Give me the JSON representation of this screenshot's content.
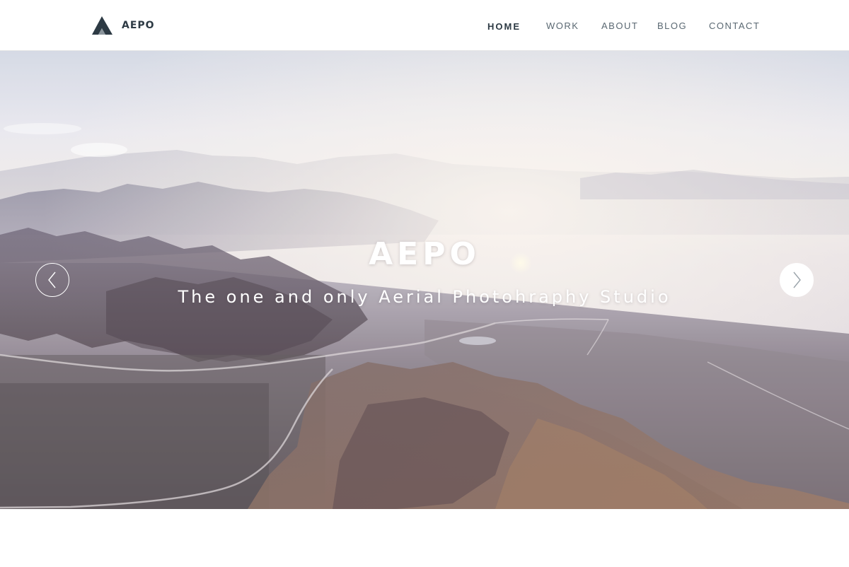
{
  "brand": {
    "name": "AEPO",
    "logo_icon": "mountain-peak-icon",
    "color": "#2d3a44"
  },
  "nav": {
    "items": [
      {
        "label": "HOME",
        "active": true
      },
      {
        "label": "WORK",
        "active": false
      },
      {
        "label": "ABOUT",
        "active": false
      },
      {
        "label": "BLOG",
        "active": false
      },
      {
        "label": "CONTACT",
        "active": false
      }
    ]
  },
  "hero": {
    "title": "AEPO",
    "subtitle": "The one and only Aerial Photohraphy Studio",
    "image": "aerial-mountain-landscape",
    "prev_icon": "chevron-left-icon",
    "next_icon": "chevron-right-icon"
  },
  "colors": {
    "text_dark": "#2d3a44",
    "text_nav": "#5a6872",
    "hero_text": "#ffffff"
  }
}
